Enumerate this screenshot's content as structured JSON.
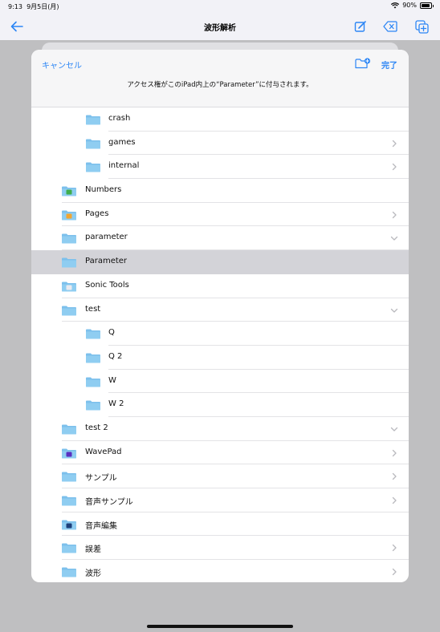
{
  "status": {
    "time": "9:13",
    "date": "9月5日(月)",
    "wifi": "wifi-icon",
    "battery_pct": "90%"
  },
  "nav": {
    "title": "波形解析"
  },
  "sheet": {
    "cancel": "キャンセル",
    "done": "完了",
    "subtitle": "アクセス権がこのiPad内上の“Parameter”に付与されます。"
  },
  "rows": [
    {
      "label": "crash",
      "level": 2,
      "icon": "folder",
      "chevron": "",
      "selected": false
    },
    {
      "label": "games",
      "level": 2,
      "icon": "folder",
      "chevron": "right",
      "selected": false
    },
    {
      "label": "internal",
      "level": 2,
      "icon": "folder",
      "chevron": "right",
      "selected": false
    },
    {
      "label": "Numbers",
      "level": 1,
      "icon": "numbers",
      "chevron": "",
      "selected": false
    },
    {
      "label": "Pages",
      "level": 1,
      "icon": "pages",
      "chevron": "right",
      "selected": false
    },
    {
      "label": "parameter",
      "level": 1,
      "icon": "folder",
      "chevron": "down",
      "selected": false
    },
    {
      "label": "Parameter",
      "level": 1,
      "icon": "folder",
      "chevron": "",
      "selected": true
    },
    {
      "label": "Sonic Tools",
      "level": 1,
      "icon": "sonic",
      "chevron": "",
      "selected": false
    },
    {
      "label": "test",
      "level": 1,
      "icon": "folder",
      "chevron": "down",
      "selected": false
    },
    {
      "label": "Q",
      "level": 2,
      "icon": "folder",
      "chevron": "",
      "selected": false
    },
    {
      "label": "Q 2",
      "level": 2,
      "icon": "folder",
      "chevron": "",
      "selected": false
    },
    {
      "label": "W",
      "level": 2,
      "icon": "folder",
      "chevron": "",
      "selected": false
    },
    {
      "label": "W 2",
      "level": 2,
      "icon": "folder",
      "chevron": "",
      "selected": false
    },
    {
      "label": "test 2",
      "level": 1,
      "icon": "folder",
      "chevron": "down",
      "selected": false
    },
    {
      "label": "WavePad",
      "level": 1,
      "icon": "wavepad",
      "chevron": "right",
      "selected": false
    },
    {
      "label": "サンプル",
      "level": 1,
      "icon": "folder",
      "chevron": "right",
      "selected": false
    },
    {
      "label": "音声サンプル",
      "level": 1,
      "icon": "folder",
      "chevron": "right",
      "selected": false
    },
    {
      "label": "音声編集",
      "level": 1,
      "icon": "audio-edit",
      "chevron": "",
      "selected": false
    },
    {
      "label": "誤差",
      "level": 1,
      "icon": "folder",
      "chevron": "right",
      "selected": false
    },
    {
      "label": "波形",
      "level": 1,
      "icon": "folder",
      "chevron": "right",
      "selected": false
    }
  ],
  "colors": {
    "accent": "#2c86f5",
    "folder": "#8fcdf1",
    "folder_tab": "#7cc0ec",
    "selected": "#d3d3d8"
  }
}
